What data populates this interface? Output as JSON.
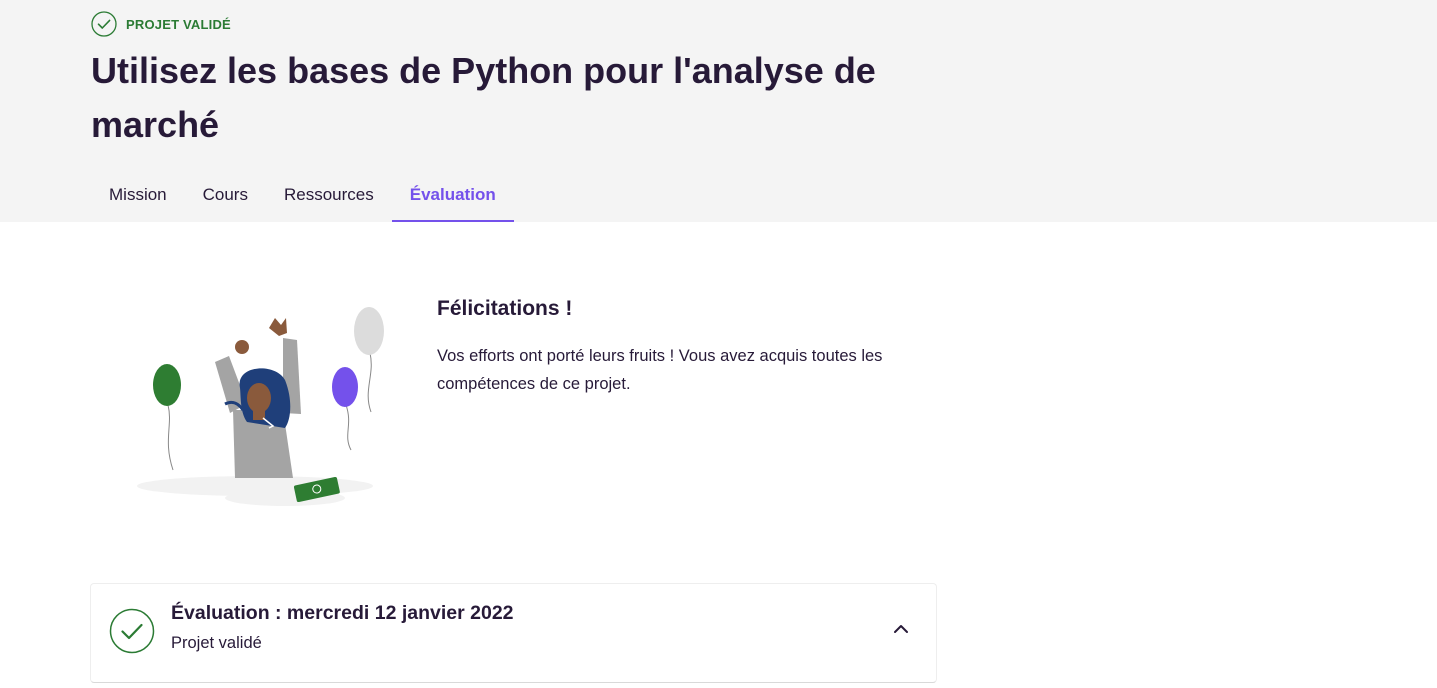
{
  "project": {
    "status_label": "PROJET VALIDÉ",
    "status_icon": "check-circle-icon",
    "title": "Utilisez les bases de Python pour l'analyse de marché"
  },
  "tabs": [
    {
      "label": "Mission",
      "active": false
    },
    {
      "label": "Cours",
      "active": false
    },
    {
      "label": "Ressources",
      "active": false
    },
    {
      "label": "Évaluation",
      "active": true
    }
  ],
  "congrats": {
    "title": "Félicitations !",
    "body": "Vos efforts ont porté leurs fruits ! Vous avez acquis toutes les compétences de ce projet."
  },
  "evaluation": {
    "title": "Évaluation : mercredi 12 janvier 2022",
    "subtitle": "Projet validé",
    "icon": "check-circle-icon",
    "toggle_icon": "chevron-up-icon"
  },
  "colors": {
    "accent": "#7451eb",
    "success": "#2b7b34",
    "text": "#271a38",
    "header_bg": "#f4f4f4"
  }
}
